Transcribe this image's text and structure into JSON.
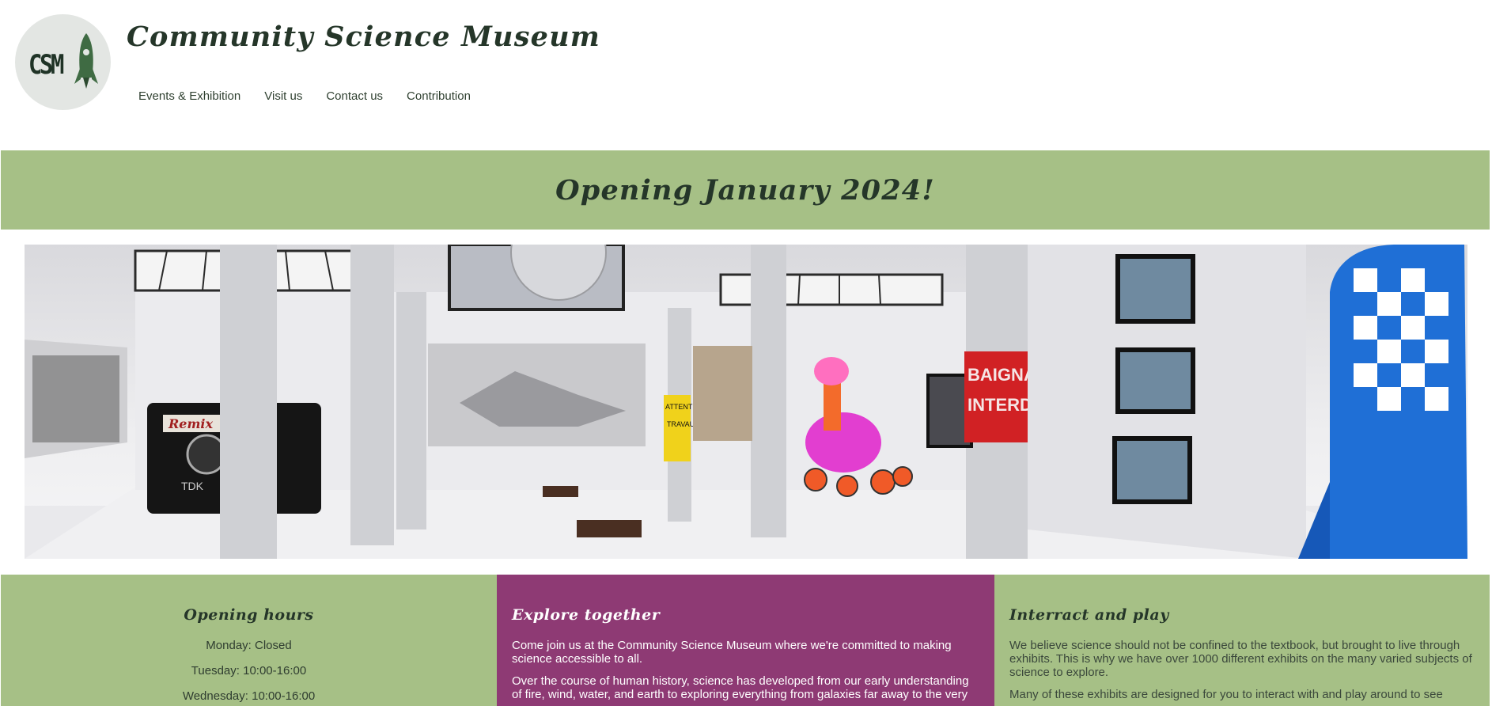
{
  "header": {
    "logo_text": "CSM",
    "title": "Community Science Museum"
  },
  "nav": {
    "items": [
      {
        "label": "Events & Exhibition"
      },
      {
        "label": "Visit us"
      },
      {
        "label": "Contact us"
      },
      {
        "label": "Contribution"
      }
    ]
  },
  "banner": {
    "text": "Opening January 2024!"
  },
  "hero": {
    "description_signs": [
      "ATTENTION",
      "TRAVAUX",
      "BAIGNADE",
      "INTERDITE",
      "Remix",
      "TDK"
    ]
  },
  "columns": {
    "hours": {
      "heading": "Opening hours",
      "lines": [
        "Monday: Closed",
        "Tuesday: 10:00-16:00",
        "Wednesday: 10:00-16:00"
      ]
    },
    "explore": {
      "heading": "Explore together",
      "paragraphs": [
        "Come join us at the Community Science Museum where we're committed to making science accessible to all.",
        "Over the course of human history, science has developed from our early understanding of fire, wind, water, and earth to exploring everything from galaxies far away to the very"
      ]
    },
    "play": {
      "heading": "Interract and play",
      "paragraphs": [
        "We believe science should not be confined to the textbook, but brought to live through exhibits. This is why we have over 1000 different exhibits on the many varied subjects of science to explore.",
        "Many of these exhibits are designed for you to interact with and play around to see"
      ]
    }
  },
  "colors": {
    "green": "#a6c086",
    "purple": "#8e3a74",
    "dark_text": "#253629"
  }
}
